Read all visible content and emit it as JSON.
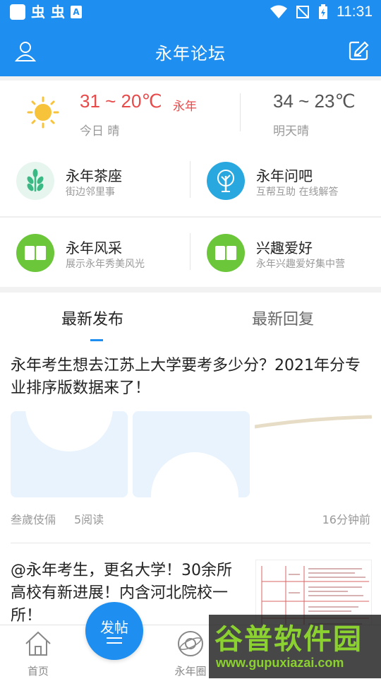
{
  "statusbar": {
    "time": "11:31",
    "notif_bug_1": "虫",
    "notif_bug_2": "虫",
    "notif_a": "A"
  },
  "header": {
    "title": "永年论坛",
    "profile_icon": "user-icon",
    "compose_icon": "edit-icon"
  },
  "weather": {
    "today": {
      "range": "31 ~ 20℃",
      "city": "永年",
      "label": "今日 晴",
      "icon": "sun-icon"
    },
    "tomorrow": {
      "range": "34 ~ 23℃",
      "label": "明天晴"
    }
  },
  "categories": [
    {
      "title": "永年茶座",
      "subtitle": "街边邻里事",
      "icon": "leaf-icon",
      "color": "#3bb985"
    },
    {
      "title": "永年问吧",
      "subtitle": "互帮互助 在线解答",
      "icon": "tree-icon",
      "color": "#29a8e0"
    },
    {
      "title": "永年风采",
      "subtitle": "展示永年秀美风光",
      "icon": "book-icon",
      "color": "#6cc63a"
    },
    {
      "title": "兴趣爱好",
      "subtitle": "永年兴趣爱好集中营",
      "icon": "book-icon",
      "color": "#6cc63a"
    }
  ],
  "tabs": [
    {
      "label": "最新发布",
      "active": true
    },
    {
      "label": "最新回复",
      "active": false
    }
  ],
  "posts": [
    {
      "title": "永年考生想去江苏上大学要考多少分？2021年分专业排序版数据来了！",
      "author": "叁歲伎倆",
      "reads": "5阅读",
      "time": "16分钟前"
    },
    {
      "title": "@永年考生，更名大学！30余所高校有新进展！内含河北院校一所！"
    }
  ],
  "bottom_nav": {
    "home_label": "首页",
    "post_label": "发帖",
    "circle_label": "永年圈"
  },
  "watermark": {
    "brand": "谷普软件园",
    "url": "www.gupuxiazai.com"
  },
  "colors": {
    "accent": "#1e8ff0",
    "temp_today": "#e84a4a"
  }
}
